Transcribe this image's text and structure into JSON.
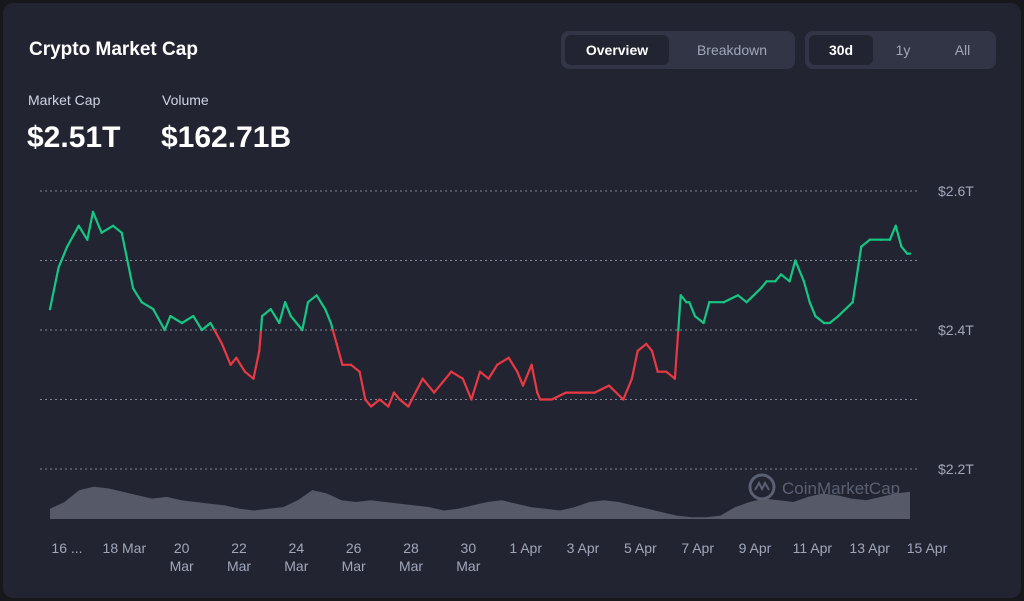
{
  "card": {
    "title": "Crypto Market Cap",
    "view_tabs": [
      "Overview",
      "Breakdown"
    ],
    "view_active": 0,
    "range_tabs": [
      "30d",
      "1y",
      "All"
    ],
    "range_active": 0,
    "stats": [
      {
        "label": "Market Cap",
        "value": "$2.51T"
      },
      {
        "label": "Volume",
        "value": "$162.71B"
      }
    ],
    "watermark": "CoinMarketCap"
  },
  "colors": {
    "up": "#16c784",
    "down": "#ea3943",
    "volume": "#5b5f6f",
    "grid": "#a1a7bb",
    "background": "#222531"
  },
  "chart_data": {
    "type": "line",
    "series_name": "Market Cap",
    "y_unit": "trillion USD",
    "ylim": [
      2.2,
      2.6
    ],
    "y_ticks": [
      {
        "value": 2.6,
        "label": "$2.6T"
      },
      {
        "value": 2.5,
        "label": ""
      },
      {
        "value": 2.4,
        "label": "$2.4T"
      },
      {
        "value": 2.3,
        "label": ""
      },
      {
        "value": 2.2,
        "label": "$2.2T"
      }
    ],
    "x_labels": [
      {
        "day": 0,
        "line1": "16 ...",
        "line2": ""
      },
      {
        "day": 2,
        "line1": "18 Mar",
        "line2": ""
      },
      {
        "day": 4,
        "line1": "20",
        "line2": "Mar"
      },
      {
        "day": 6,
        "line1": "22",
        "line2": "Mar"
      },
      {
        "day": 8,
        "line1": "24",
        "line2": "Mar"
      },
      {
        "day": 10,
        "line1": "26",
        "line2": "Mar"
      },
      {
        "day": 12,
        "line1": "28",
        "line2": "Mar"
      },
      {
        "day": 14,
        "line1": "30",
        "line2": "Mar"
      },
      {
        "day": 16,
        "line1": "1 Apr",
        "line2": ""
      },
      {
        "day": 18,
        "line1": "3 Apr",
        "line2": ""
      },
      {
        "day": 20,
        "line1": "5 Apr",
        "line2": ""
      },
      {
        "day": 22,
        "line1": "7 Apr",
        "line2": ""
      },
      {
        "day": 24,
        "line1": "9 Apr",
        "line2": ""
      },
      {
        "day": 26,
        "line1": "11 Apr",
        "line2": ""
      },
      {
        "day": 28,
        "line1": "13 Apr",
        "line2": ""
      },
      {
        "day": 30,
        "line1": "15 Apr",
        "line2": ""
      }
    ],
    "x_days": [
      0,
      0.3,
      0.6,
      1.0,
      1.3,
      1.5,
      1.8,
      2.2,
      2.5,
      2.9,
      3.2,
      3.6,
      4.0,
      4.2,
      4.6,
      5.0,
      5.3,
      5.6,
      6.0,
      6.3,
      6.5,
      6.8,
      7.1,
      7.3,
      7.4,
      7.7,
      8.0,
      8.2,
      8.4,
      8.8,
      9.0,
      9.3,
      9.6,
      9.8,
      10.0,
      10.2,
      10.5,
      10.8,
      11.0,
      11.2,
      11.5,
      11.8,
      12.0,
      12.2,
      12.5,
      13.0,
      13.4,
      14.0,
      14.4,
      14.7,
      15.0,
      15.3,
      15.6,
      16.0,
      16.3,
      16.5,
      16.8,
      17.0,
      17.1,
      17.5,
      18.0,
      18.5,
      19.0,
      19.5,
      20.0,
      20.3,
      20.5,
      20.8,
      21.0,
      21.2,
      21.5,
      21.8,
      22.0,
      22.2,
      22.3,
      22.5,
      22.8,
      23.0,
      23.5,
      24.0,
      24.3,
      24.8,
      25.0,
      25.3,
      25.5,
      25.8,
      26.0,
      26.3,
      26.5,
      26.7,
      27.0,
      27.2,
      27.5,
      28.0,
      28.3,
      28.6,
      29.0,
      29.3,
      29.5,
      29.7,
      29.9,
      30.0
    ],
    "values": [
      2.43,
      2.49,
      2.52,
      2.55,
      2.53,
      2.57,
      2.54,
      2.55,
      2.54,
      2.46,
      2.44,
      2.43,
      2.4,
      2.42,
      2.41,
      2.42,
      2.4,
      2.41,
      2.38,
      2.35,
      2.36,
      2.34,
      2.33,
      2.37,
      2.42,
      2.43,
      2.41,
      2.44,
      2.42,
      2.4,
      2.44,
      2.45,
      2.43,
      2.41,
      2.38,
      2.35,
      2.35,
      2.34,
      2.3,
      2.29,
      2.3,
      2.29,
      2.31,
      2.3,
      2.29,
      2.33,
      2.31,
      2.34,
      2.33,
      2.3,
      2.34,
      2.33,
      2.35,
      2.36,
      2.34,
      2.32,
      2.35,
      2.31,
      2.3,
      2.3,
      2.31,
      2.31,
      2.31,
      2.32,
      2.3,
      2.33,
      2.37,
      2.38,
      2.37,
      2.34,
      2.34,
      2.33,
      2.45,
      2.44,
      2.44,
      2.42,
      2.41,
      2.44,
      2.44,
      2.45,
      2.44,
      2.46,
      2.47,
      2.47,
      2.48,
      2.47,
      2.5,
      2.47,
      2.44,
      2.42,
      2.41,
      2.41,
      2.42,
      2.44,
      2.52,
      2.53,
      2.53,
      2.53,
      2.55,
      2.52,
      2.51,
      2.51
    ],
    "volume_relative": [
      0.3,
      0.5,
      0.85,
      0.95,
      0.9,
      0.8,
      0.7,
      0.6,
      0.65,
      0.55,
      0.5,
      0.45,
      0.4,
      0.3,
      0.25,
      0.3,
      0.35,
      0.55,
      0.85,
      0.75,
      0.55,
      0.5,
      0.55,
      0.5,
      0.45,
      0.4,
      0.35,
      0.25,
      0.3,
      0.4,
      0.5,
      0.55,
      0.45,
      0.35,
      0.3,
      0.25,
      0.35,
      0.5,
      0.55,
      0.5,
      0.4,
      0.3,
      0.2,
      0.1,
      0.05,
      0.05,
      0.1,
      0.35,
      0.5,
      0.6,
      0.55,
      0.5,
      0.65,
      0.75,
      0.7,
      0.6,
      0.55,
      0.65,
      0.75,
      0.8
    ]
  }
}
